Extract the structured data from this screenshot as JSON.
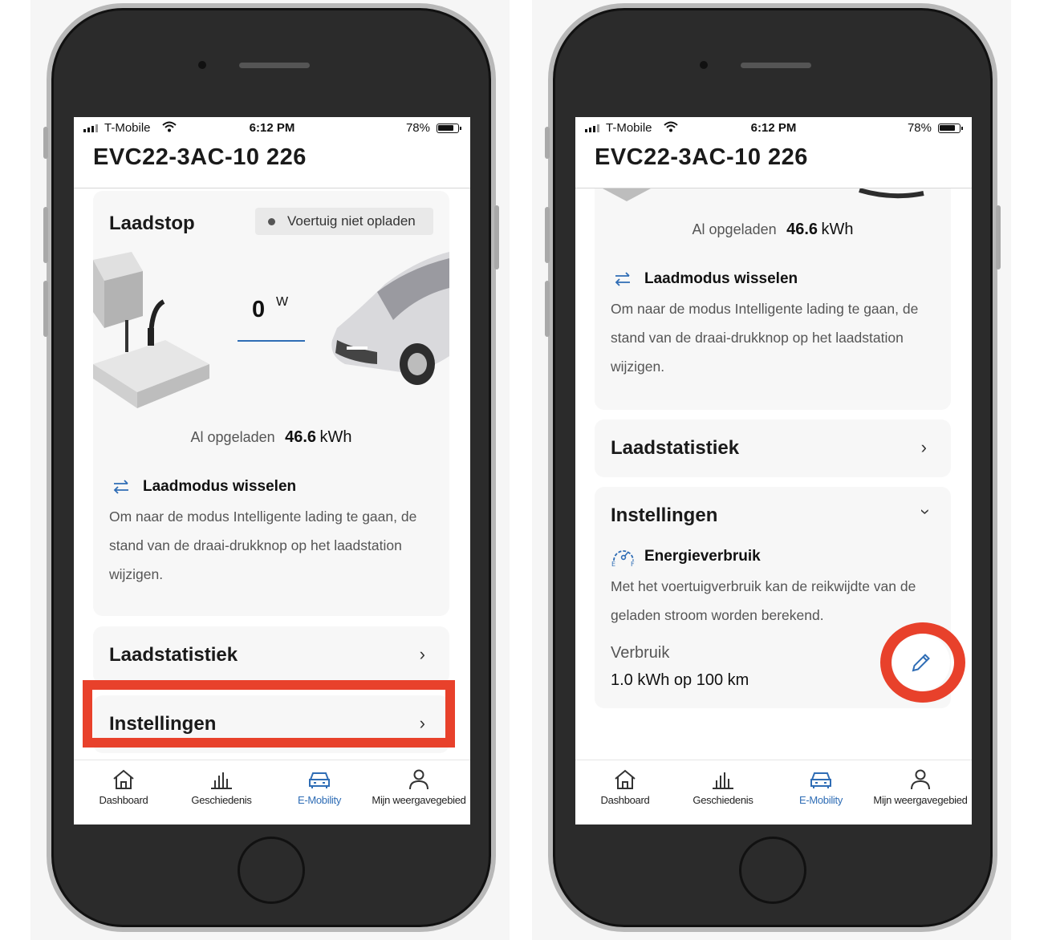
{
  "colors": {
    "accent": "#2f6db5",
    "highlight": "#e8412b"
  },
  "status": {
    "carrier": "T-Mobile",
    "time": "6:12 PM",
    "battery": "78%"
  },
  "device_title": "EVC22-3AC-10 226",
  "left": {
    "card_title": "Laadstop",
    "status_pill": "Voertuig niet opladen",
    "power_value": "0",
    "power_unit": "W",
    "charged_label": "Al opgeladen",
    "charged_value": "46.6",
    "charged_unit": "kWh",
    "mode_title": "Laadmodus wisselen",
    "mode_text": "Om naar de modus Intelligente lading te gaan, de stand van de draai-drukknop op het laadstation wijzigen.",
    "stats_title": "Laadstatistiek",
    "settings_title": "Instellingen"
  },
  "right": {
    "charged_label": "Al opgeladen",
    "charged_value": "46.6",
    "charged_unit": "kWh",
    "mode_title": "Laadmodus wisselen",
    "mode_text": "Om naar de modus Intelligente lading te gaan, de stand van de draai-drukknop op het laadstation wijzigen.",
    "stats_title": "Laadstatistiek",
    "settings_title": "Instellingen",
    "energy_title": "Energieverbruik",
    "energy_text": "Met het voertuigverbruik kan de reikwijdte van de geladen stroom worden berekend.",
    "usage_label": "Verbruik",
    "usage_value": "1.0 kWh op 100 km"
  },
  "tabs": [
    {
      "label": "Dashboard",
      "icon": "home-icon"
    },
    {
      "label": "Geschiedenis",
      "icon": "bar-chart-icon"
    },
    {
      "label": "E-Mobility",
      "icon": "car-icon",
      "active": true
    },
    {
      "label": "Mijn weergavegebied",
      "icon": "person-icon"
    }
  ]
}
